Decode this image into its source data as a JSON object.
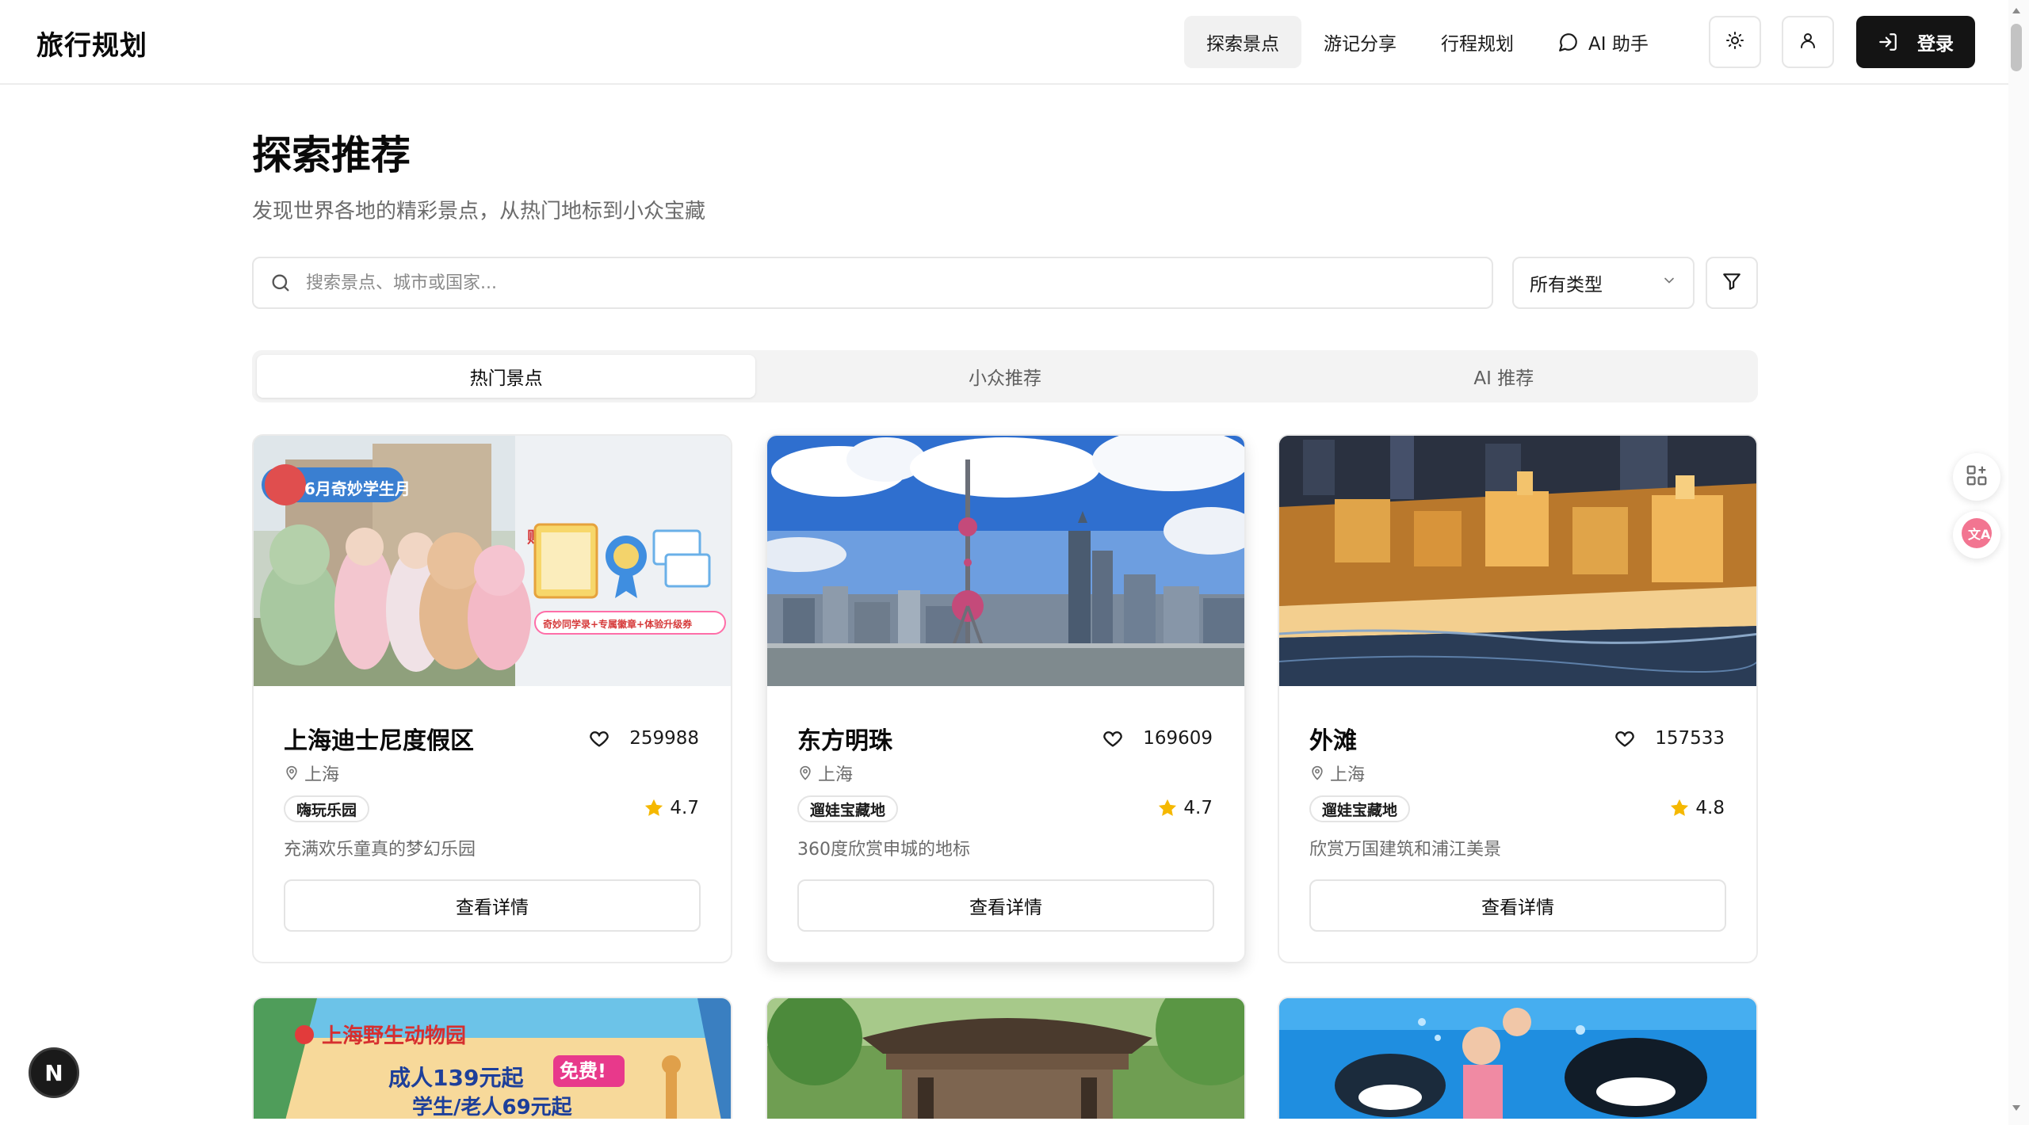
{
  "header": {
    "brand": "旅行规划",
    "nav": [
      {
        "label": "探索景点",
        "active": true
      },
      {
        "label": "游记分享",
        "active": false
      },
      {
        "label": "行程规划",
        "active": false
      },
      {
        "label": "AI 助手",
        "active": false,
        "icon": "chat-bubble-icon"
      }
    ],
    "theme_icon": "sun-icon",
    "user_icon": "user-icon",
    "login_label": "登录",
    "login_icon": "log-in-icon"
  },
  "main": {
    "title": "探索推荐",
    "subtitle": "发现世界各地的精彩景点，从热门地标到小众宝藏",
    "search": {
      "placeholder": "搜索景点、城市或国家...",
      "value": ""
    },
    "type_select": {
      "value": "所有类型"
    },
    "tabs": [
      {
        "label": "热门景点",
        "active": true
      },
      {
        "label": "小众推荐",
        "active": false
      },
      {
        "label": "AI 推荐",
        "active": false
      }
    ],
    "cards": [
      {
        "name": "上海迪士尼度假区",
        "favorites": "259988",
        "location": "上海",
        "tag": "嗨玩乐园",
        "rating": "4.7",
        "description": "充满欢乐童真的梦幻乐园",
        "button": "查看详情",
        "image_text": {
          "banner": "6月奇妙学生月",
          "gift": "赠:",
          "promo": "奇妙同学录+专属徽章+体验升级券"
        }
      },
      {
        "name": "东方明珠",
        "favorites": "169609",
        "location": "上海",
        "tag": "遛娃宝藏地",
        "rating": "4.7",
        "description": "360度欣赏申城的地标",
        "button": "查看详情"
      },
      {
        "name": "外滩",
        "favorites": "157533",
        "location": "上海",
        "tag": "遛娃宝藏地",
        "rating": "4.8",
        "description": "欣赏万国建筑和浦江美景",
        "button": "查看详情"
      }
    ],
    "next_row_images": [
      {
        "image_text": {
          "title": "上海野生动物园",
          "adult": "成人139元起",
          "student": "学生/老人69元起",
          "free": "免费!"
        }
      },
      {
        "image": "pavilion"
      },
      {
        "image": "aquarium"
      }
    ]
  },
  "floating": {
    "apps_icon": "apps-plus-icon",
    "translate_icon": "translate-icon",
    "dev_badge": "N"
  },
  "colors": {
    "accent": "#141414",
    "muted_text": "#6b6b6b",
    "border": "#e6e6e6",
    "star": "#f5b800"
  }
}
